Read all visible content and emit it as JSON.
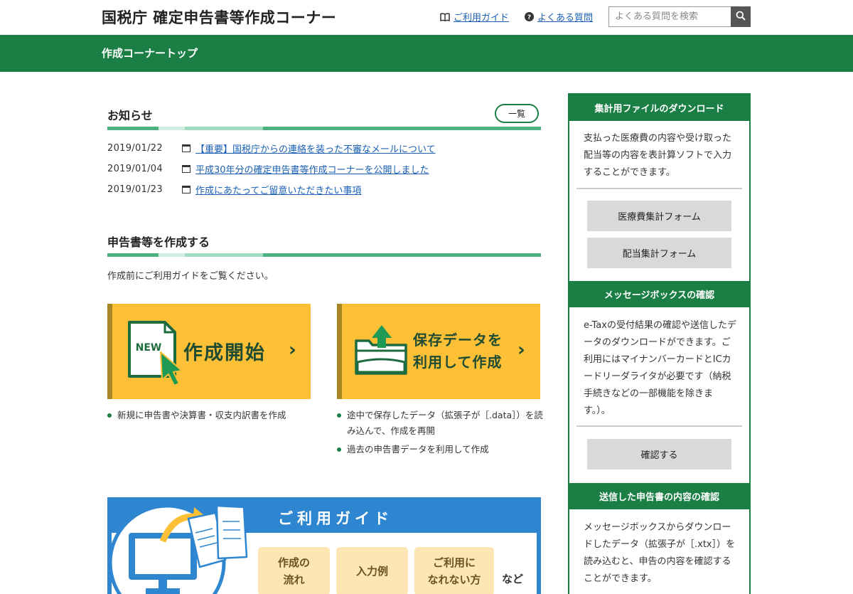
{
  "header": {
    "site_title": "国税庁 確定申告書等作成コーナー",
    "guide_link": "ご利用ガイド",
    "faq_link": "よくある質問",
    "search_placeholder": "よくある質問を検索",
    "page_title": "作成コーナートップ",
    "icons": [
      "book-icon",
      "question-circle-icon",
      "search-icon"
    ]
  },
  "news": {
    "title": "お知らせ",
    "list_button": "一覧",
    "items": [
      {
        "date": "2019/01/22",
        "text": "【重要】国税庁からの連絡を装った不審なメールについて"
      },
      {
        "date": "2019/01/04",
        "text": "平成30年分の確定申告書等作成コーナーを公開しました"
      },
      {
        "date": "2019/01/23",
        "text": "作成にあたってご留意いただきたい事項"
      }
    ]
  },
  "create": {
    "title": "申告書等を作成する",
    "intro": "作成前にご利用ガイドをご覧ください。",
    "new_button": {
      "badge": "NEW",
      "label": "作成開始",
      "chevron": "›"
    },
    "saved_button": {
      "line1": "保存データを",
      "line2": "利用して作成",
      "chevron": "›"
    },
    "new_bullets": [
      "新規に申告書や決算書・収支内訳書を作成"
    ],
    "saved_bullets": [
      "途中で保存したデータ（拡張子が［.data］）を読み込んで、作成を再開",
      "過去の申告書データを利用して作成"
    ]
  },
  "guide_banner": {
    "title": "ご利用ガイド",
    "chip1_line1": "作成の",
    "chip1_line2": "流れ",
    "chip2": "入力例",
    "chip3_line1": "ご利用に",
    "chip3_line2": "なれない方",
    "etc": "など"
  },
  "sidebar": {
    "download": {
      "heading": "集計用ファイルのダウンロード",
      "text": "支払った医療費の内容や受け取った配当等の内容を表計算ソフトで入力することができます。",
      "button1": "医療費集計フォーム",
      "button2": "配当集計フォーム"
    },
    "messagebox": {
      "heading": "メッセージボックスの確認",
      "text": "e-Taxの受付結果の確認や送信したデータのダウンロードができます。ご利用にはマイナンバーカードとICカードリーダライタが必要です（納税手続きなどの一部機能を除きます。）。",
      "button": "確認する"
    },
    "sent": {
      "heading": "送信した申告書の内容の確認",
      "text": "メッセージボックスからダウンロードしたデータ（拡張子が［.xtx］）を読み込むと、申告の内容を確認することができます。"
    }
  },
  "colors": {
    "brand_green": "#1b7f45",
    "button_yellow": "#fbc036",
    "guide_blue": "#2e86d0",
    "link_blue": "#1a5fb4"
  }
}
